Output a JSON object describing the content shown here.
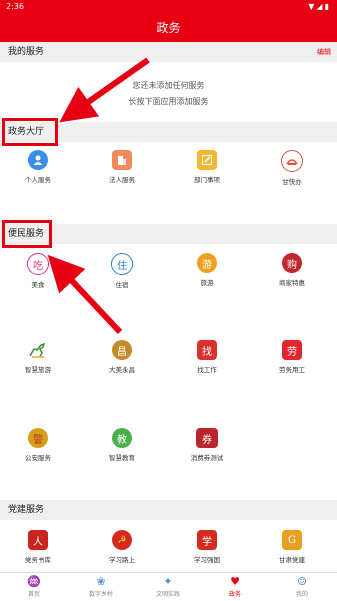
{
  "status": {
    "time": "2:36",
    "signal_icons": "▼◢▮"
  },
  "title": "政务",
  "my_services": {
    "label": "我的服务",
    "edit": "编辑",
    "empty_line1": "您还未添加任何服务",
    "empty_line2": "长按下面应用添加服务"
  },
  "gov_hall": {
    "label": "政务大厅",
    "items": [
      {
        "label": "个人服务",
        "icon": "person-icon",
        "color": "#3a8ee6"
      },
      {
        "label": "法人服务",
        "icon": "building-icon",
        "color": "#f08a5d"
      },
      {
        "label": "部门事项",
        "icon": "edit-icon",
        "color": "#f5b52e"
      },
      {
        "label": "甘快办",
        "icon": "gankuaiban-icon",
        "color": "#e64b3c"
      }
    ]
  },
  "convenience": {
    "label": "便民服务",
    "items": [
      {
        "label": "美食",
        "icon": "food-icon",
        "glyph": "吃",
        "color": "#d6338f"
      },
      {
        "label": "住宿",
        "icon": "lodging-icon",
        "glyph": "住",
        "color": "#2a7fd4"
      },
      {
        "label": "旅游",
        "icon": "travel-icon",
        "glyph": "游",
        "color": "#f0a020"
      },
      {
        "label": "商家特惠",
        "icon": "merchant-icon",
        "glyph": "购",
        "color": "#c0282d"
      },
      {
        "label": "智慧旅游",
        "icon": "horse-icon",
        "glyph": "马",
        "color": "#3a8f3a"
      },
      {
        "label": "大美永昌",
        "icon": "yongchang-icon",
        "glyph": "昌",
        "color": "#c58a2a"
      },
      {
        "label": "找工作",
        "icon": "job-icon",
        "glyph": "找",
        "color": "#d9322a"
      },
      {
        "label": "劳务用工",
        "icon": "labor-icon",
        "glyph": "劳",
        "color": "#e0262e"
      },
      {
        "label": "公安服务",
        "icon": "police-badge-icon",
        "glyph": "警",
        "color": "#d4a017"
      },
      {
        "label": "智慧教育",
        "icon": "education-icon",
        "glyph": "教",
        "color": "#4bb04b"
      },
      {
        "label": "消费券测试",
        "icon": "coupon-icon",
        "glyph": "券",
        "color": "#b8262e"
      }
    ]
  },
  "party": {
    "label": "党建服务",
    "items": [
      {
        "label": "党务书库",
        "icon": "book-icon",
        "glyph": "人",
        "color": "#c9241f"
      },
      {
        "label": "学习路上",
        "icon": "party-emblem-icon",
        "glyph": "☭",
        "color": "#d42a1f"
      },
      {
        "label": "学习强国",
        "icon": "xuexi-icon",
        "glyph": "学",
        "color": "#d42a1f"
      },
      {
        "label": "甘肃党建",
        "icon": "gansu-party-icon",
        "glyph": "G",
        "color": "#e8a020"
      }
    ]
  },
  "tabs": [
    {
      "label": "首页",
      "icon": "home-icon",
      "glyph": "♒"
    },
    {
      "label": "数字乡村",
      "icon": "heart-hands-icon",
      "glyph": "❀"
    },
    {
      "label": "文明实践",
      "icon": "practice-icon",
      "glyph": "✦"
    },
    {
      "label": "政务",
      "icon": "gov-heart-icon",
      "glyph": "♥"
    },
    {
      "label": "我的",
      "icon": "user-icon",
      "glyph": "☺"
    }
  ]
}
